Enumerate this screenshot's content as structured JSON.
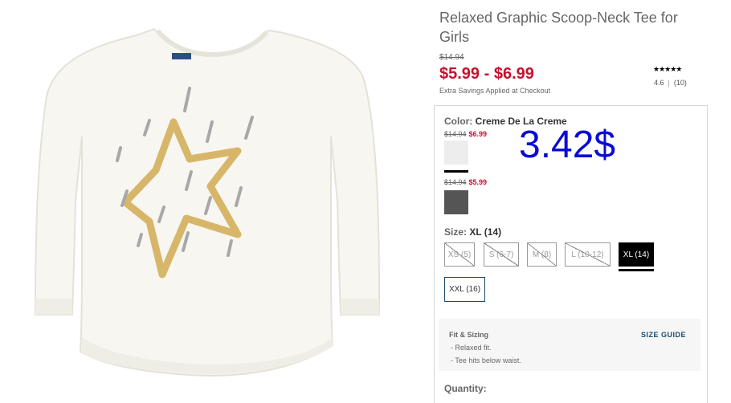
{
  "product": {
    "title": "Relaxed Graphic Scoop-Neck Tee for Girls",
    "original_price": "$14.94",
    "price_range": "$5.99 - $6.99",
    "savings_note": "Extra Savings Applied at Checkout",
    "stars": "★★★★★",
    "rating": "4.6",
    "review_count": "(10)"
  },
  "color": {
    "label": "Color:",
    "selected": "Creme De La Creme",
    "swatches": [
      {
        "original": "$14.94",
        "sale": "$6.99",
        "color": "#ededed"
      },
      {
        "original": "$14.94",
        "sale": "$5.99",
        "color": "#555555"
      }
    ]
  },
  "overlay_price": "3.42$",
  "size": {
    "label": "Size:",
    "selected": "XL (14)",
    "options": [
      {
        "label": "XS (5)",
        "available": false
      },
      {
        "label": "S (6-7)",
        "available": false
      },
      {
        "label": "M (8)",
        "available": false
      },
      {
        "label": "L (10-12)",
        "available": false
      },
      {
        "label": "XL (14)",
        "available": true,
        "selected": true
      },
      {
        "label": "XXL (16)",
        "available": true
      }
    ]
  },
  "fit": {
    "title": "Fit & Sizing",
    "size_guide": "SIZE GUIDE",
    "items": [
      "- Relaxed fit.",
      "- Tee hits below waist."
    ]
  },
  "quantity_label": "Quantity:",
  "colors": {
    "sale_red": "#c8102e",
    "selected_black": "#000000",
    "overlay_blue": "#0a0ad6",
    "link_blue": "#1a4b6e"
  }
}
